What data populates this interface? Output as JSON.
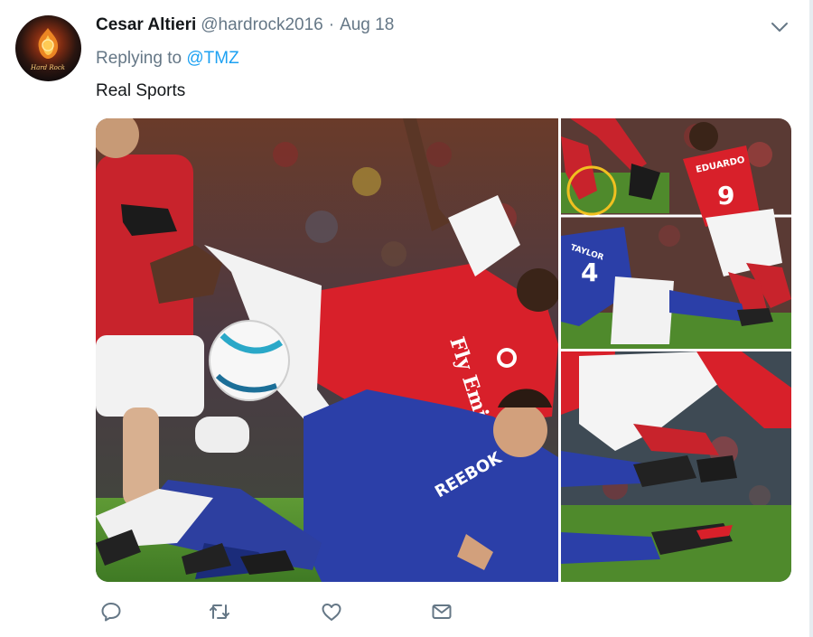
{
  "tweet": {
    "display_name": "Cesar Altieri",
    "username": "@hardrock2016",
    "separator": "·",
    "timestamp": "Aug 18",
    "reply_prefix": "Replying to",
    "reply_mention": "@TMZ",
    "text": "Real Sports",
    "avatar_text": "Hard Rock",
    "media": {
      "main_shirt_sponsor": "Fly Emirates",
      "main_opponent_sponsor": "REEBOK",
      "top_right_shirt_name": "EDUARDO",
      "top_right_shirt_number": "9",
      "top_right_opponent_name": "TAYLOR",
      "top_right_opponent_number": "4"
    },
    "actions": {
      "reply_icon": "reply-icon",
      "retweet_icon": "retweet-icon",
      "like_icon": "heart-icon",
      "dm_icon": "envelope-icon"
    }
  },
  "colors": {
    "name": "#14171a",
    "secondary": "#657786",
    "link": "#1da1f2",
    "arsenal_red": "#d8202a",
    "bolton_blue": "#2b3fa8",
    "pitch_green": "#4f8a2c"
  }
}
